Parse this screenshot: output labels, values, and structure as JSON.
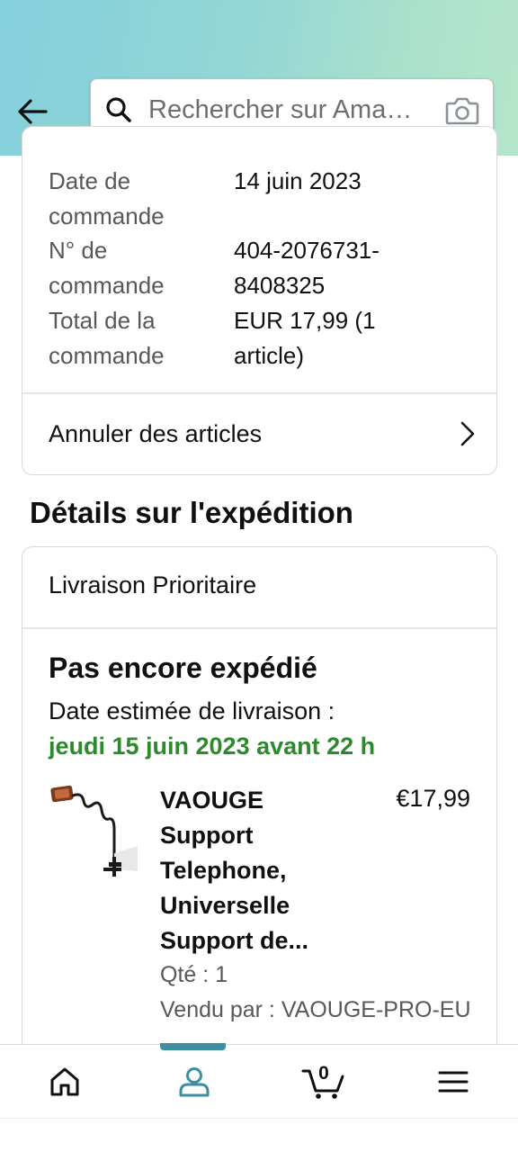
{
  "search": {
    "placeholder": "Rechercher sur Ama…"
  },
  "order_summary": {
    "rows": [
      {
        "label": "Date de commande",
        "value": "14 juin 2023"
      },
      {
        "label": "N° de commande",
        "value": "404-2076731-8408325"
      },
      {
        "label": "Total de la commande",
        "value": "EUR 17,99 (1 article)"
      }
    ],
    "cancel_label": "Annuler des articles"
  },
  "shipment": {
    "section_title": "Détails sur l'expédition",
    "method": "Livraison Prioritaire",
    "status": "Pas encore expédié",
    "estimated_label": "Date estimée de livraison :",
    "estimated_date": "jeudi 15 juin 2023 avant 22 h",
    "product": {
      "title": "VAOUGE Support Telephone, Universelle Support de...",
      "price": "€17,99",
      "quantity": "Qté : 1",
      "seller": "Vendu par : VAOUGE-PRO-EU"
    }
  },
  "bottom_nav": {
    "cart_count": "0",
    "items": [
      "home-icon",
      "account-icon",
      "cart-icon",
      "menu-icon"
    ],
    "active_index": 1
  },
  "colors": {
    "accent": "#3d8e9e",
    "delivery_green": "#2c8a2c",
    "border": "#d5d9d9"
  }
}
